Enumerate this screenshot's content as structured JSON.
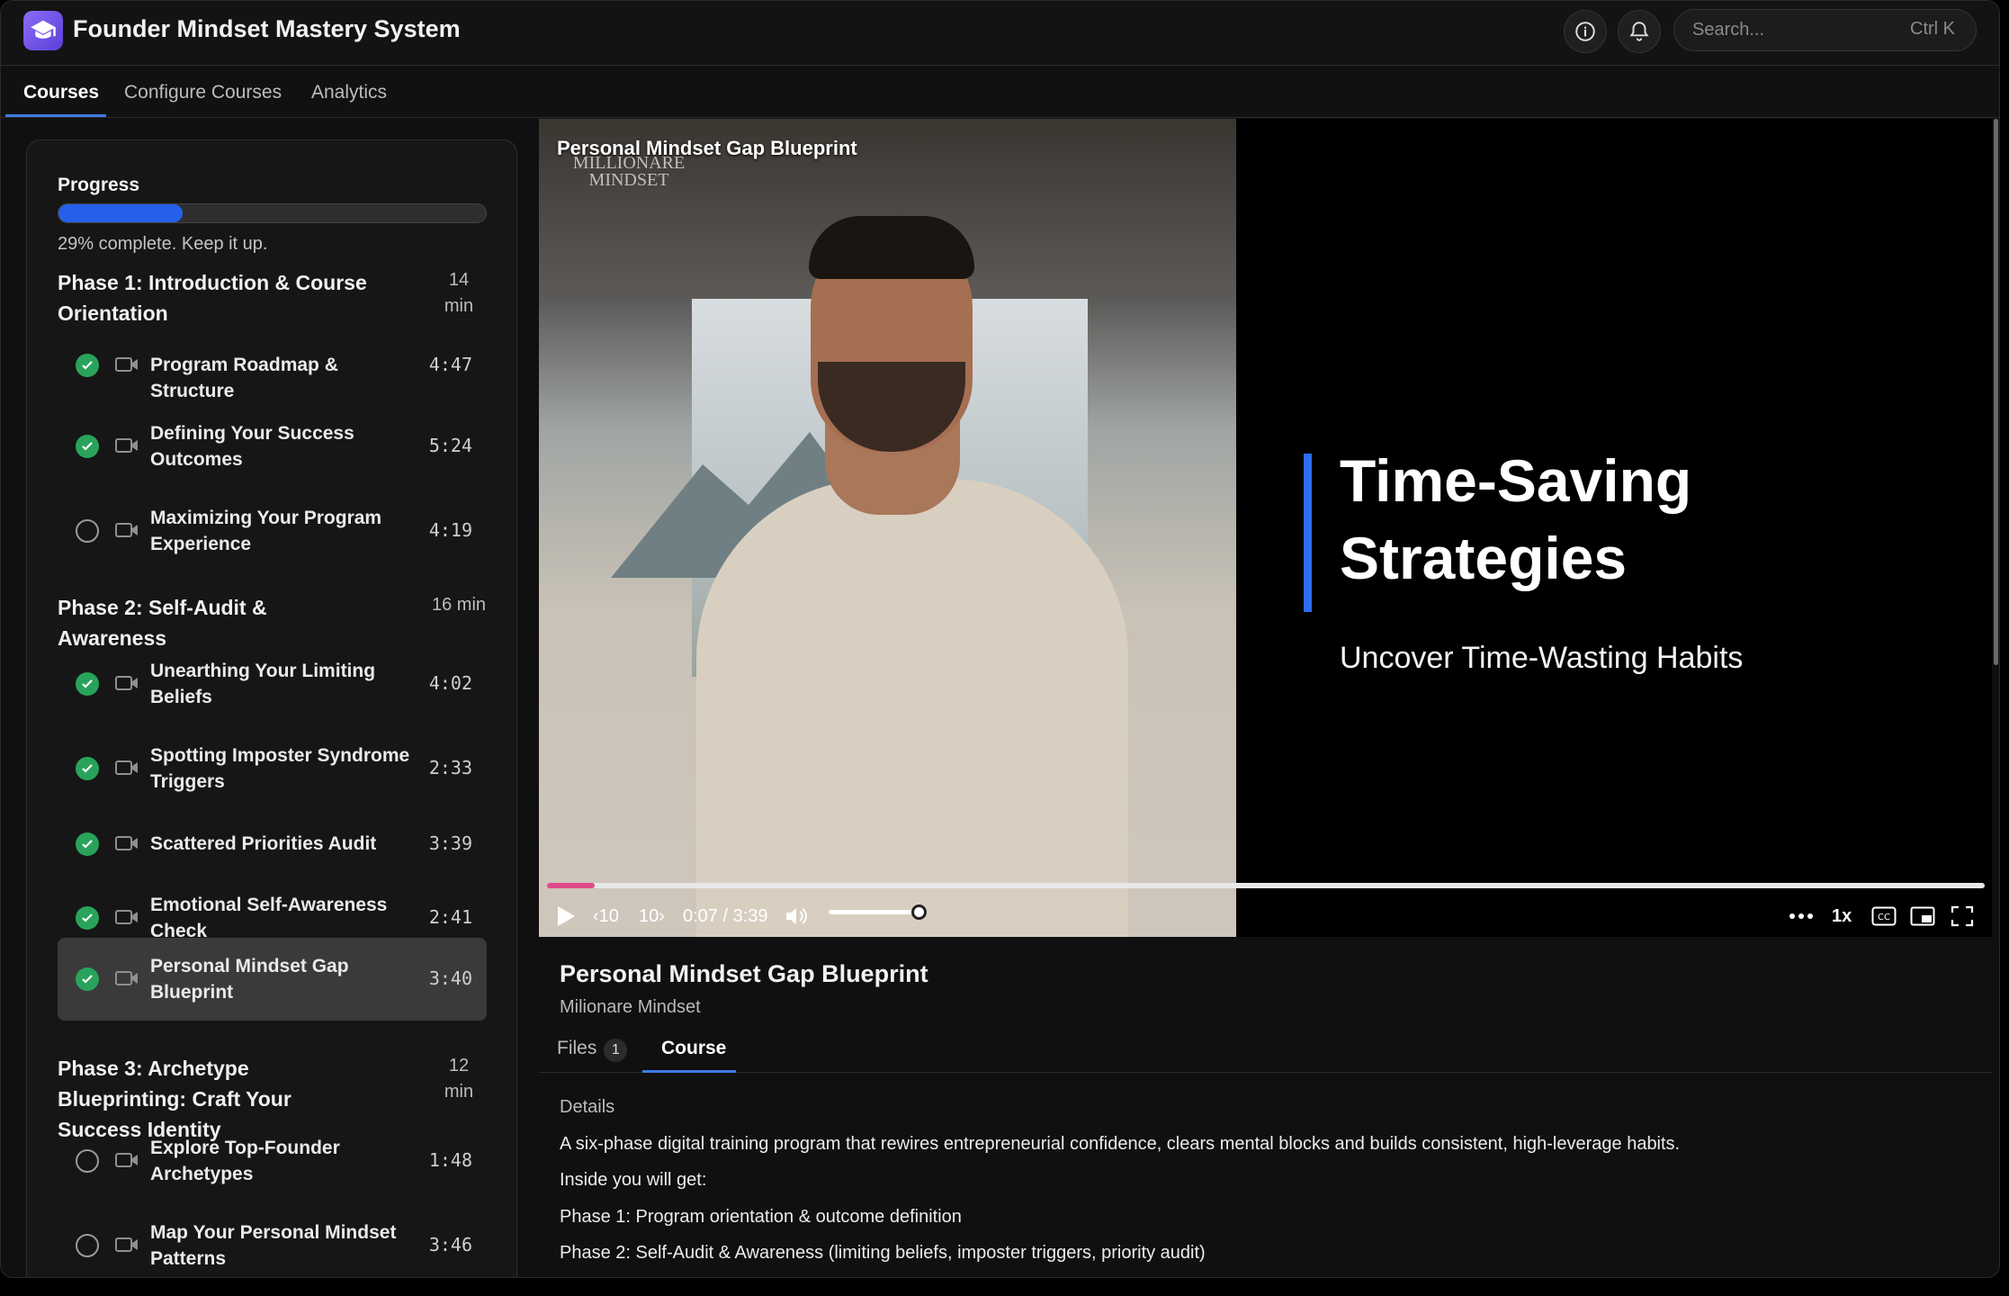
{
  "header": {
    "app_title": "Founder Mindset Mastery System",
    "search_placeholder": "Search...",
    "search_shortcut": "Ctrl K"
  },
  "nav": {
    "tabs": [
      "Courses",
      "Configure Courses",
      "Analytics"
    ],
    "active": "Courses"
  },
  "sidebar": {
    "progress_label": "Progress",
    "progress_percent": 29,
    "progress_text": "29% complete. Keep it up.",
    "phases": [
      {
        "title": "Phase 1: Introduction & Course Orientation",
        "time": "14 min",
        "lessons": [
          {
            "title": "Program Roadmap & Structure",
            "time": "4:47",
            "done": true
          },
          {
            "title": "Defining Your Success Outcomes",
            "time": "5:24",
            "done": true
          },
          {
            "title": "Maximizing Your Program Experience",
            "time": "4:19",
            "done": false
          }
        ]
      },
      {
        "title": "Phase 2: Self-Audit & Awareness",
        "time": "16 min",
        "lessons": [
          {
            "title": "Unearthing Your Limiting Beliefs",
            "time": "4:02",
            "done": true
          },
          {
            "title": "Spotting Imposter Syndrome Triggers",
            "time": "2:33",
            "done": true
          },
          {
            "title": "Scattered Priorities Audit",
            "time": "3:39",
            "done": true
          },
          {
            "title": "Emotional Self-Awareness Check",
            "time": "2:41",
            "done": true
          },
          {
            "title": "Personal Mindset Gap Blueprint",
            "time": "3:40",
            "done": true,
            "active": true
          }
        ]
      },
      {
        "title": "Phase 3: Archetype Blueprinting: Craft Your Success Identity",
        "time": "12 min",
        "lessons": [
          {
            "title": "Explore Top-Founder Archetypes",
            "time": "1:48",
            "done": false
          },
          {
            "title": "Map Your Personal Mindset Patterns",
            "time": "3:46",
            "done": false
          }
        ]
      }
    ]
  },
  "video": {
    "overlay_title": "Personal Mindset Gap Blueprint",
    "watermark": "MILLIONARE MINDSET",
    "slide_heading_1": "Time-Saving",
    "slide_heading_2": "Strategies",
    "slide_subtitle": "Uncover Time-Wasting Habits",
    "current_time": "0:07",
    "duration": "3:39",
    "time_display": "0:07 / 3:39",
    "played_fraction": 0.033,
    "volume_fraction": 0.87,
    "rewind_label": "10",
    "forward_label": "10",
    "speed": "1x",
    "cc_label": "CC"
  },
  "lesson": {
    "title": "Personal Mindset Gap Blueprint",
    "author": "Milionare Mindset",
    "tabs": {
      "files": "Files",
      "files_count": "1",
      "course": "Course"
    },
    "details_heading": "Details",
    "details_lines": [
      "A six-phase digital training program that rewires entrepreneurial confidence, clears mental blocks and builds consistent, high-leverage habits.",
      "Inside you will get:",
      "Phase 1: Program orientation & outcome definition",
      "Phase 2: Self-Audit & Awareness (limiting beliefs, imposter triggers, priority audit)"
    ]
  },
  "colors": {
    "accent": "#3f7be8",
    "progress": "#2460ea",
    "check": "#29a35b",
    "seek_played": "#e24a8a"
  }
}
